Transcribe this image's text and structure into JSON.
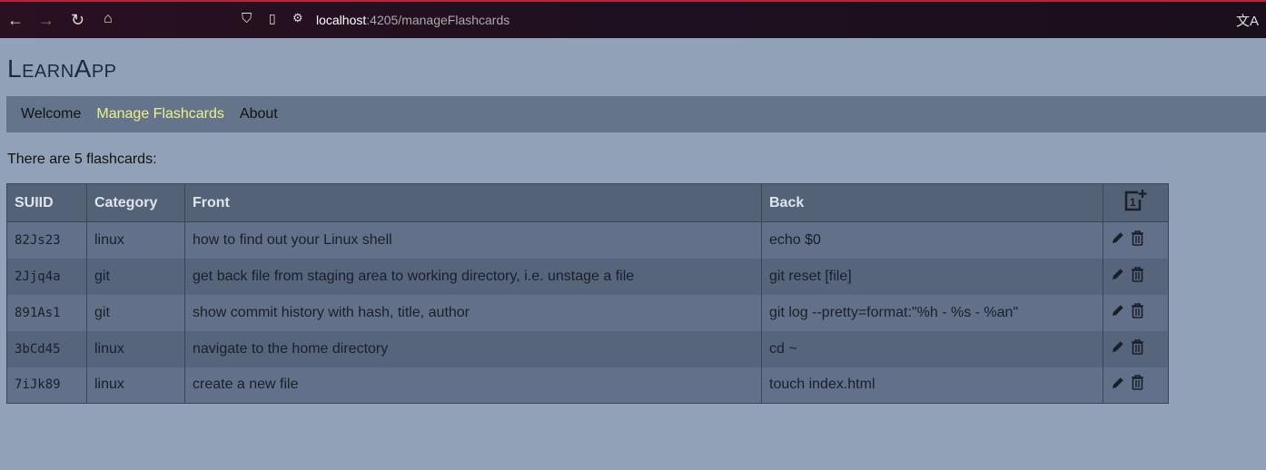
{
  "browser": {
    "url_host": "localhost",
    "url_path": ":4205/manageFlashcards"
  },
  "app_title": "LearnApp",
  "nav": [
    {
      "label": "Welcome"
    },
    {
      "label": "Manage Flashcards"
    },
    {
      "label": "About"
    }
  ],
  "count_text": "There are 5 flashcards:",
  "table": {
    "headers": {
      "id": "SUIID",
      "category": "Category",
      "front": "Front",
      "back": "Back"
    },
    "rows": [
      {
        "id": "82Js23",
        "category": "linux",
        "front": "how to find out your Linux shell",
        "back": "echo $0"
      },
      {
        "id": "2Jjq4a",
        "category": "git",
        "front": "get back file from staging area to working directory, i.e. unstage a file",
        "back": "git reset [file]"
      },
      {
        "id": "891As1",
        "category": "git",
        "front": "show commit history with hash, title, author",
        "back": "git log --pretty=format:\"%h - %s - %an\""
      },
      {
        "id": "3bCd45",
        "category": "linux",
        "front": "navigate to the home directory",
        "back": "cd ~"
      },
      {
        "id": "7iJk89",
        "category": "linux",
        "front": "create a new file",
        "back": "touch index.html"
      }
    ]
  },
  "colors": {
    "active_nav": "#f0f08a",
    "nav_bg": "#64758b",
    "page_bg": "#91a2b8"
  }
}
